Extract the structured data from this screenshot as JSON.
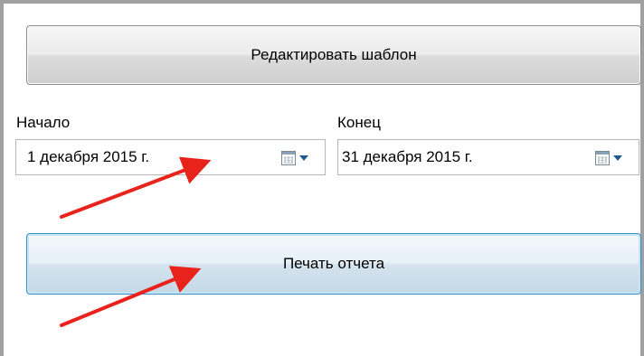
{
  "buttons": {
    "edit_template": "Редактировать шаблон",
    "print_report": "Печать отчета"
  },
  "fields": {
    "start": {
      "label": "Начало",
      "value": "1 декабря  2015 г."
    },
    "end": {
      "label": "Конец",
      "value": "31 декабря  2015 г."
    }
  },
  "icons": {
    "date_picker_button": "calendar-dropdown-icon",
    "annotation": "red-arrow"
  },
  "colors": {
    "annotation_arrow": "#e8231c",
    "focused_button_border": "#3c8fc8"
  }
}
